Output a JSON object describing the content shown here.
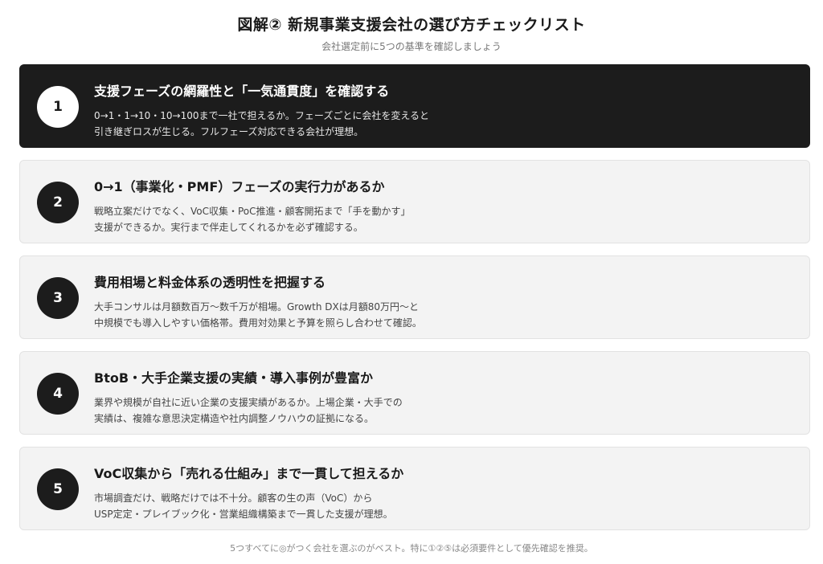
{
  "header": {
    "title": "図解② 新規事業支援会社の選び方チェックリスト",
    "subtitle": "会社選定前に5つの基準を確認しましょう"
  },
  "items": [
    {
      "number": "1",
      "heading": "支援フェーズの網羅性と「一気通貫度」を確認する",
      "line1": "0→1・1→10・10→100まで一社で担えるか。フェーズごとに会社を変えると",
      "line2": "引き継ぎロスが生じる。フルフェーズ対応できる会社が理想。",
      "highlighted": true
    },
    {
      "number": "2",
      "heading": "0→1（事業化・PMF）フェーズの実行力があるか",
      "line1": "戦略立案だけでなく、VoC収集・PoC推進・顧客開拓まで「手を動かす」",
      "line2": "支援ができるか。実行まで伴走してくれるかを必ず確認する。",
      "highlighted": false
    },
    {
      "number": "3",
      "heading": "費用相場と料金体系の透明性を把握する",
      "line1": "大手コンサルは月額数百万〜数千万が相場。Growth DXは月額80万円〜と",
      "line2": "中規模でも導入しやすい価格帯。費用対効果と予算を照らし合わせて確認。",
      "highlighted": false
    },
    {
      "number": "4",
      "heading": "BtoB・大手企業支援の実績・導入事例が豊富か",
      "line1": "業界や規模が自社に近い企業の支援実績があるか。上場企業・大手での",
      "line2": "実績は、複雑な意思決定構造や社内調整ノウハウの証拠になる。",
      "highlighted": false
    },
    {
      "number": "5",
      "heading": "VoC収集から「売れる仕組み」まで一貫して担えるか",
      "line1": "市場調査だけ、戦略だけでは不十分。顧客の生の声（VoC）から",
      "line2": "USP定定・プレイブック化・営業組織構築まで一貫した支援が理想。",
      "highlighted": false
    }
  ],
  "footer": {
    "note": "5つすべてに◎がつく会社を選ぶのがベスト。特に①②⑤は必須要件として優先確認を推奨。"
  }
}
